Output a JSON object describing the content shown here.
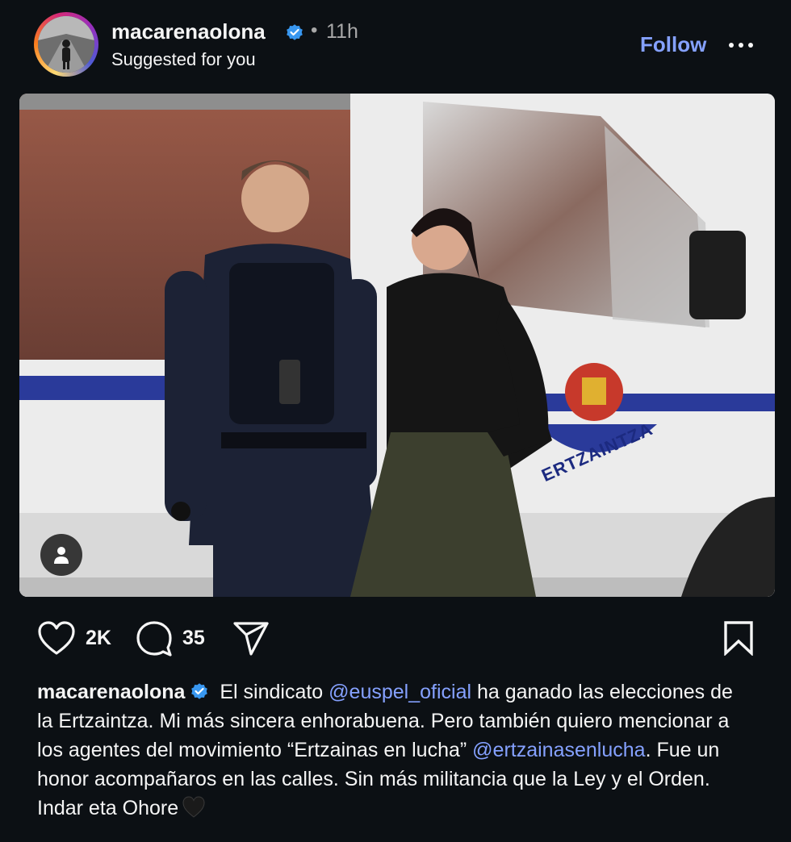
{
  "post": {
    "username": "macarenaolona",
    "time_separator": "•",
    "time": "11h",
    "subtitle": "Suggested for you",
    "follow_label": "Follow"
  },
  "actions": {
    "likes": "2K",
    "comments": "35"
  },
  "caption": {
    "username": "macarenaolona",
    "part1": " El sindicato ",
    "mention1": "@euspel_oficial",
    "part2": " ha ganado las elecciones de la Ertzaintza. Mi más sincera enhorabuena. Pero también quiero mencionar a los agentes del movimiento “Ertzainas en lucha” ",
    "mention2": "@ertzainasenlucha",
    "part3": ". Fue un honor acompañaros en las calles. Sin más militancia que la Ley y el Orden. Indar eta Ohore"
  },
  "photo": {
    "van_text": "ERTZAINTZA"
  },
  "icons": {
    "verified": "verified-badge-icon",
    "more": "more-dots-icon",
    "like": "heart-icon",
    "comment": "comment-bubble-icon",
    "share": "paper-plane-icon",
    "save": "bookmark-icon",
    "tag": "user-tag-icon",
    "emoji": "black-heart-emoji"
  },
  "colors": {
    "background": "#0c1014",
    "text": "#f5f5f5",
    "muted": "#a8a8a8",
    "link": "#85a1ff",
    "verified": "#3897f0"
  }
}
